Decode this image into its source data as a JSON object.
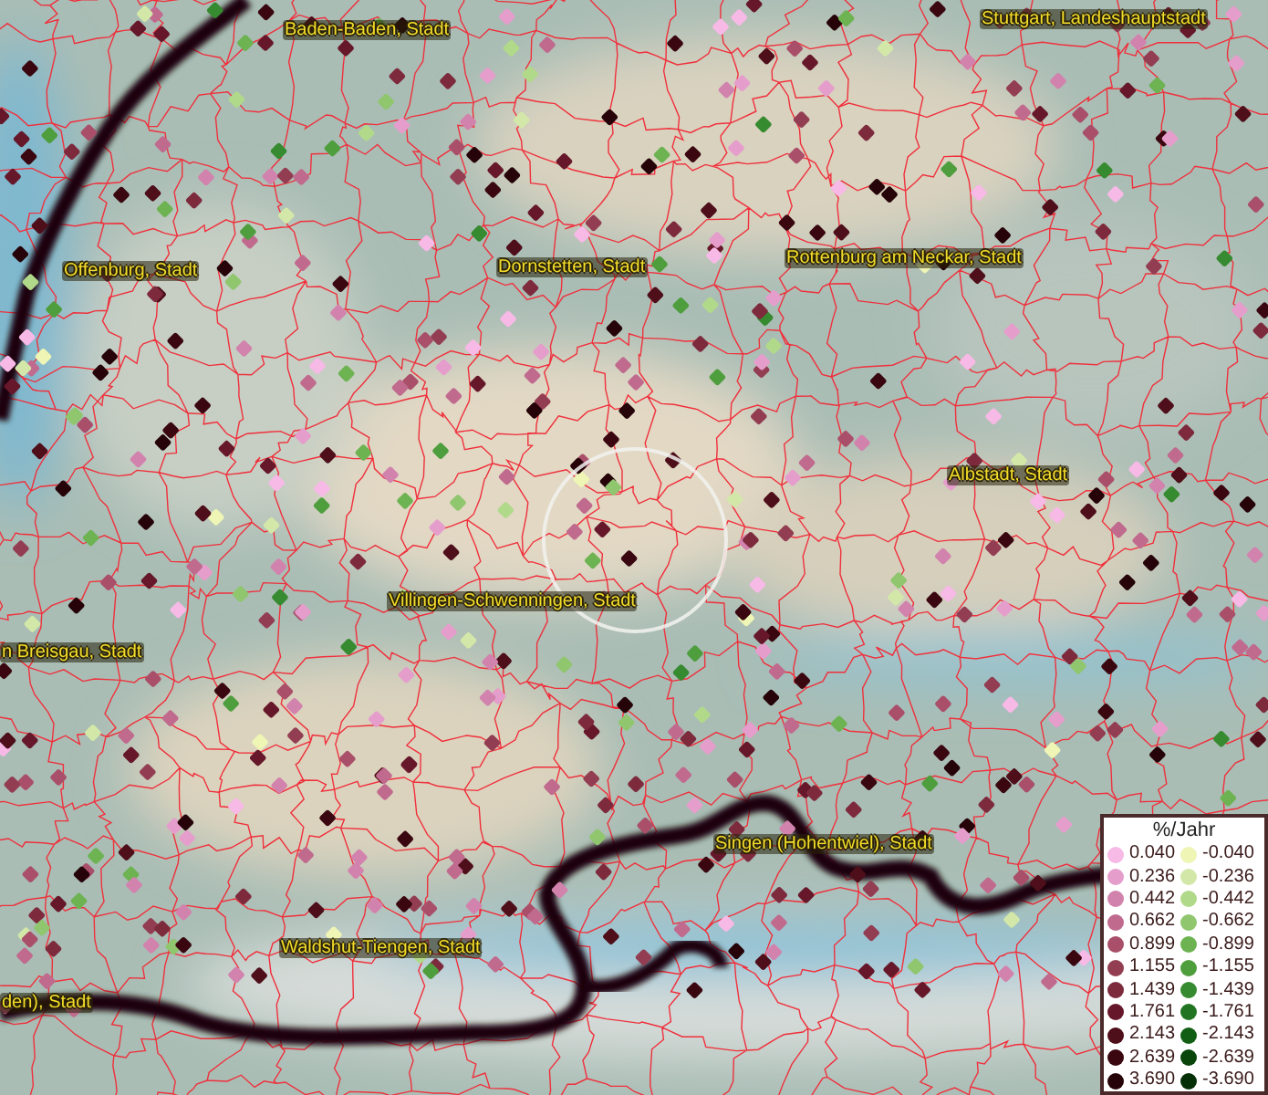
{
  "map": {
    "place_labels": [
      "Baden-Baden, Stadt",
      "Stuttgart, Landeshauptstadt",
      "Offenburg, Stadt",
      "Dornstetten, Stadt",
      "Rottenburg am Neckar, Stadt",
      "Albstadt, Stadt",
      "Villingen-Schwenningen, Stadt",
      "n Breisgau, Stadt",
      "Singen (Hohentwiel), Stadt",
      "Waldshut-Tiengen, Stadt",
      "den), Stadt"
    ]
  },
  "legend": {
    "title": "%/Jahr",
    "columns": [
      [
        {
          "label": "0.040",
          "color": "#f7b9e6"
        },
        {
          "label": "0.236",
          "color": "#e59ecc"
        },
        {
          "label": "0.442",
          "color": "#d283ad"
        },
        {
          "label": "0.662",
          "color": "#c06a8e"
        },
        {
          "label": "0.899",
          "color": "#a94f6a"
        },
        {
          "label": "1.155",
          "color": "#933d52"
        },
        {
          "label": "1.439",
          "color": "#7d2a3d"
        },
        {
          "label": "1.761",
          "color": "#66182a"
        },
        {
          "label": "2.143",
          "color": "#4e0e1a"
        },
        {
          "label": "2.639",
          "color": "#3a0710"
        },
        {
          "label": "3.690",
          "color": "#250308"
        }
      ],
      [
        {
          "label": "-0.040",
          "color": "#eef5b5"
        },
        {
          "label": "-0.236",
          "color": "#d3e8a8"
        },
        {
          "label": "-0.442",
          "color": "#b1d98a"
        },
        {
          "label": "-0.662",
          "color": "#8fc66e"
        },
        {
          "label": "-0.899",
          "color": "#6db352"
        },
        {
          "label": "-1.155",
          "color": "#4f9e3e"
        },
        {
          "label": "-1.439",
          "color": "#368a2f"
        },
        {
          "label": "-1.761",
          "color": "#217522"
        },
        {
          "label": "-2.143",
          "color": "#135e15"
        },
        {
          "label": "-2.639",
          "color": "#0a450c"
        },
        {
          "label": "-3.690",
          "color": "#052f07"
        }
      ]
    ]
  }
}
